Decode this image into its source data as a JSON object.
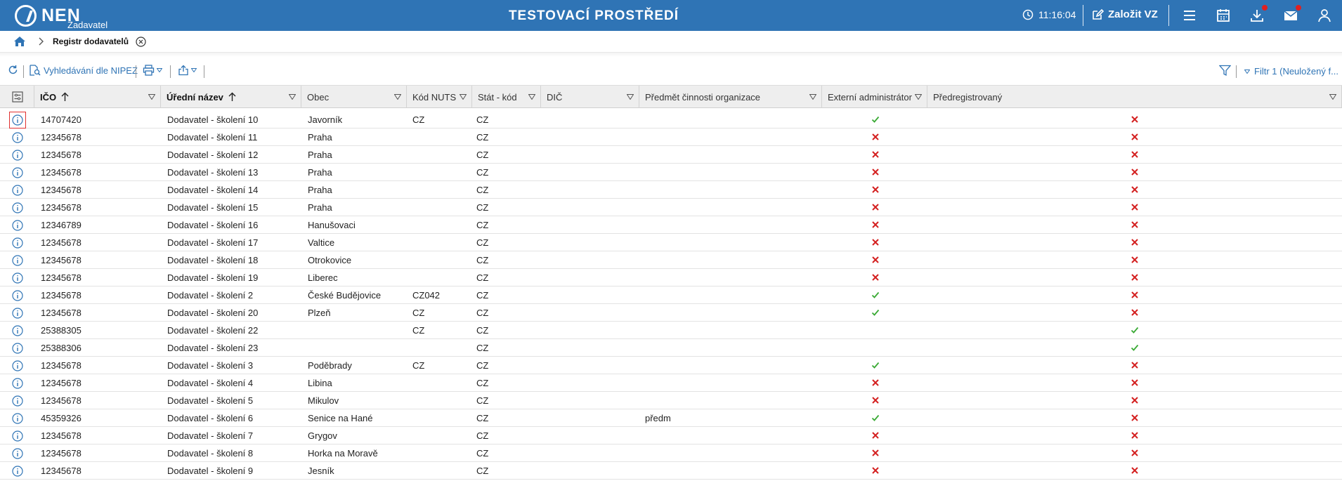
{
  "header": {
    "logo_text": "NEN",
    "logo_subtitle": "Zadavatel",
    "environment_title": "TESTOVACÍ PROSTŘEDÍ",
    "time": "11:16:04",
    "create_button_label": "Založit VZ"
  },
  "breadcrumb": {
    "current": "Registr dodavatelů"
  },
  "toolbar": {
    "nipez_search_label": "Vyhledávání dle NIPEZ",
    "filter_label": "Filtr 1 (Neuložený f..."
  },
  "table": {
    "columns": [
      {
        "key": "ico",
        "label": "IČO",
        "bold": true,
        "sort": "asc"
      },
      {
        "key": "name",
        "label": "Úřední název",
        "bold": true,
        "sort": "asc"
      },
      {
        "key": "obec",
        "label": "Obec"
      },
      {
        "key": "nuts",
        "label": "Kód NUTS"
      },
      {
        "key": "stat",
        "label": "Stát - kód"
      },
      {
        "key": "dic",
        "label": "DIČ"
      },
      {
        "key": "predmet",
        "label": "Předmět činnosti organizace"
      },
      {
        "key": "ext_admin",
        "label": "Externí administrátor"
      },
      {
        "key": "prereg",
        "label": "Předregistrovaný"
      }
    ],
    "rows": [
      {
        "ico": "14707420",
        "name": "Dodavatel - školení 10",
        "obec": "Javorník",
        "nuts": "CZ",
        "stat": "CZ",
        "dic": "",
        "predmet": "",
        "ext_admin": "yes",
        "prereg": "no"
      },
      {
        "ico": "12345678",
        "name": "Dodavatel - školení 11",
        "obec": "Praha",
        "nuts": "",
        "stat": "CZ",
        "dic": "",
        "predmet": "",
        "ext_admin": "no",
        "prereg": "no"
      },
      {
        "ico": "12345678",
        "name": "Dodavatel - školení 12",
        "obec": "Praha",
        "nuts": "",
        "stat": "CZ",
        "dic": "",
        "predmet": "",
        "ext_admin": "no",
        "prereg": "no"
      },
      {
        "ico": "12345678",
        "name": "Dodavatel - školení 13",
        "obec": "Praha",
        "nuts": "",
        "stat": "CZ",
        "dic": "",
        "predmet": "",
        "ext_admin": "no",
        "prereg": "no"
      },
      {
        "ico": "12345678",
        "name": "Dodavatel - školení 14",
        "obec": "Praha",
        "nuts": "",
        "stat": "CZ",
        "dic": "",
        "predmet": "",
        "ext_admin": "no",
        "prereg": "no"
      },
      {
        "ico": "12345678",
        "name": "Dodavatel - školení 15",
        "obec": "Praha",
        "nuts": "",
        "stat": "CZ",
        "dic": "",
        "predmet": "",
        "ext_admin": "no",
        "prereg": "no"
      },
      {
        "ico": "12346789",
        "name": "Dodavatel - školení 16",
        "obec": "Hanušovaci",
        "nuts": "",
        "stat": "CZ",
        "dic": "",
        "predmet": "",
        "ext_admin": "no",
        "prereg": "no"
      },
      {
        "ico": "12345678",
        "name": "Dodavatel - školení 17",
        "obec": "Valtice",
        "nuts": "",
        "stat": "CZ",
        "dic": "",
        "predmet": "",
        "ext_admin": "no",
        "prereg": "no"
      },
      {
        "ico": "12345678",
        "name": "Dodavatel - školení 18",
        "obec": "Otrokovice",
        "nuts": "",
        "stat": "CZ",
        "dic": "",
        "predmet": "",
        "ext_admin": "no",
        "prereg": "no"
      },
      {
        "ico": "12345678",
        "name": "Dodavatel - školení 19",
        "obec": "Liberec",
        "nuts": "",
        "stat": "CZ",
        "dic": "",
        "predmet": "",
        "ext_admin": "no",
        "prereg": "no"
      },
      {
        "ico": "12345678",
        "name": "Dodavatel - školení 2",
        "obec": "České Budějovice",
        "nuts": "CZ042",
        "stat": "CZ",
        "dic": "",
        "predmet": "",
        "ext_admin": "yes",
        "prereg": "no"
      },
      {
        "ico": "12345678",
        "name": "Dodavatel - školení 20",
        "obec": "Plzeň",
        "nuts": "CZ",
        "stat": "CZ",
        "dic": "",
        "predmet": "",
        "ext_admin": "yes",
        "prereg": "no"
      },
      {
        "ico": "25388305",
        "name": "Dodavatel - školení 22",
        "obec": "",
        "nuts": "CZ",
        "stat": "CZ",
        "dic": "",
        "predmet": "",
        "ext_admin": "",
        "prereg": "yes"
      },
      {
        "ico": "25388306",
        "name": "Dodavatel - školení 23",
        "obec": "",
        "nuts": "",
        "stat": "CZ",
        "dic": "",
        "predmet": "",
        "ext_admin": "",
        "prereg": "yes"
      },
      {
        "ico": "12345678",
        "name": "Dodavatel - školení 3",
        "obec": "Poděbrady",
        "nuts": "CZ",
        "stat": "CZ",
        "dic": "",
        "predmet": "",
        "ext_admin": "yes",
        "prereg": "no"
      },
      {
        "ico": "12345678",
        "name": "Dodavatel - školení 4",
        "obec": "Libina",
        "nuts": "",
        "stat": "CZ",
        "dic": "",
        "predmet": "",
        "ext_admin": "no",
        "prereg": "no"
      },
      {
        "ico": "12345678",
        "name": "Dodavatel - školení 5",
        "obec": "Mikulov",
        "nuts": "",
        "stat": "CZ",
        "dic": "",
        "predmet": "",
        "ext_admin": "no",
        "prereg": "no"
      },
      {
        "ico": "45359326",
        "name": "Dodavatel - školení 6",
        "obec": "Senice na Hané",
        "nuts": "",
        "stat": "CZ",
        "dic": "",
        "predmet": "předm",
        "ext_admin": "yes",
        "prereg": "no"
      },
      {
        "ico": "12345678",
        "name": "Dodavatel - školení 7",
        "obec": "Grygov",
        "nuts": "",
        "stat": "CZ",
        "dic": "",
        "predmet": "",
        "ext_admin": "no",
        "prereg": "no"
      },
      {
        "ico": "12345678",
        "name": "Dodavatel - školení 8",
        "obec": "Horka na Moravě",
        "nuts": "",
        "stat": "CZ",
        "dic": "",
        "predmet": "",
        "ext_admin": "no",
        "prereg": "no"
      },
      {
        "ico": "12345678",
        "name": "Dodavatel - školení 9",
        "obec": "Jesník",
        "nuts": "",
        "stat": "CZ",
        "dic": "",
        "predmet": "",
        "ext_admin": "no",
        "prereg": "no"
      }
    ]
  },
  "colors": {
    "brand": "#2f74b5",
    "check": "#3aaa35",
    "cross": "#d42020"
  }
}
